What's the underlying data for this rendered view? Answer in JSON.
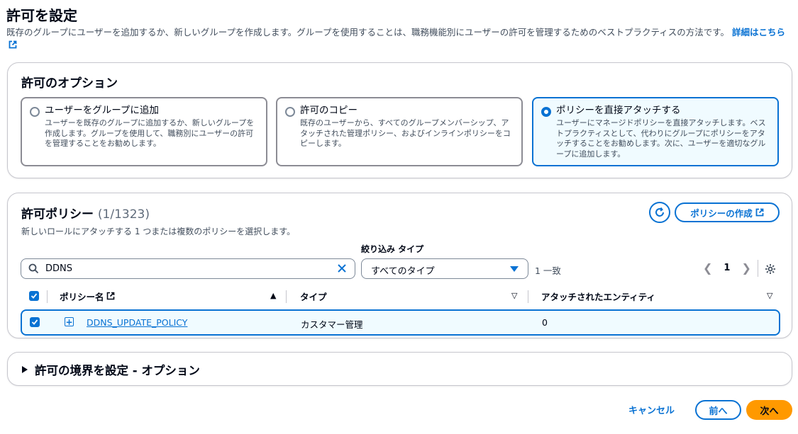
{
  "page": {
    "title": "許可を設定",
    "description": "既存のグループにユーザーを追加するか、新しいグループを作成します。グループを使用することは、職務機能別にユーザーの許可を管理するためのベストプラクティスの方法です。",
    "learn_more": "詳細はこちら"
  },
  "options": {
    "title": "許可のオプション",
    "tiles": [
      {
        "title": "ユーザーをグループに追加",
        "desc": "ユーザーを既存のグループに追加するか、新しいグループを作成します。グループを使用して、職務別にユーザーの許可を管理することをお勧めします。",
        "selected": false
      },
      {
        "title": "許可のコピー",
        "desc": "既存のユーザーから、すべてのグループメンバーシップ、アタッチされた管理ポリシー、およびインラインポリシーをコピーします。",
        "selected": false
      },
      {
        "title": "ポリシーを直接アタッチする",
        "desc": "ユーザーにマネージドポリシーを直接アタッチします。ベストプラクティスとして、代わりにグループにポリシーをアタッチすることをお勧めします。次に、ユーザーを適切なグループに追加します。",
        "selected": true
      }
    ]
  },
  "policies": {
    "title": "許可ポリシー",
    "count": "(1/1323)",
    "description": "新しいロールにアタッチする 1 つまたは複数のポリシーを選択します。",
    "create_button": "ポリシーの作成",
    "filter_label": "絞り込み タイプ",
    "search_value": "DDNS",
    "filter_type_value": "すべてのタイプ",
    "match_text": "1 一致",
    "page_number": "1",
    "columns": [
      "ポリシー名",
      "タイプ",
      "アタッチされたエンティティ"
    ],
    "rows": [
      {
        "name": "DDNS_UPDATE_POLICY",
        "type": "カスタマー管理",
        "entities": "0",
        "checked": true
      }
    ]
  },
  "boundary": {
    "title": "許可の境界を設定 - オプション"
  },
  "footer": {
    "cancel": "キャンセル",
    "prev": "前へ",
    "next": "次へ"
  },
  "colors": {
    "accent": "#0972d3",
    "primary_button": "#ff9900",
    "selected_bg": "#f0fbff"
  }
}
